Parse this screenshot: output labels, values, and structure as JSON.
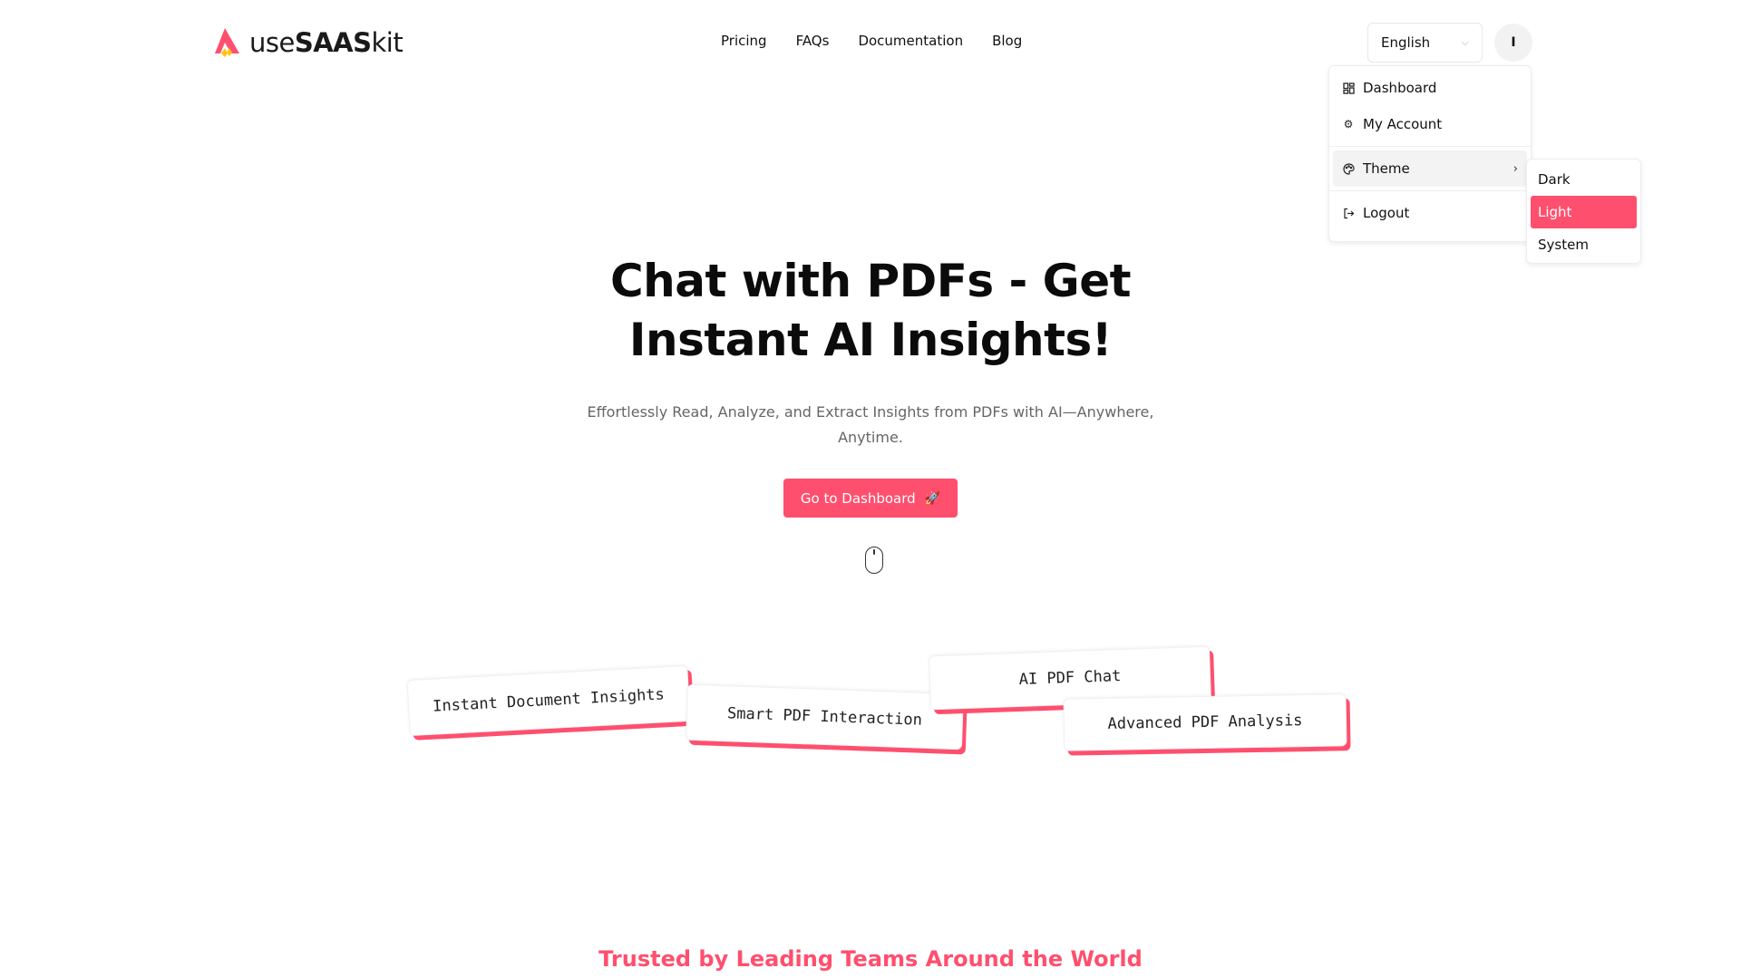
{
  "brand": {
    "logo_prefix": "use",
    "logo_bold": "SAAS",
    "logo_suffix": "kit",
    "accent_color": "#ff4f6e",
    "logo_secondary_color": "#ffc21a"
  },
  "nav": {
    "links": [
      {
        "label": "Pricing"
      },
      {
        "label": "FAQs"
      },
      {
        "label": "Documentation"
      },
      {
        "label": "Blog"
      }
    ]
  },
  "header": {
    "language": {
      "selected": "English",
      "icon": "chevron-down-icon"
    },
    "avatar_initial": "I"
  },
  "user_menu": {
    "items": [
      {
        "label": "Dashboard",
        "icon": "dashboard-icon"
      },
      {
        "label": "My Account",
        "icon": "gear-icon"
      },
      {
        "label": "Theme",
        "icon": "palette-icon",
        "has_submenu": true
      },
      {
        "label": "Logout",
        "icon": "logout-icon"
      }
    ],
    "theme_submenu": {
      "options": [
        {
          "label": "Dark"
        },
        {
          "label": "Light"
        },
        {
          "label": "System"
        }
      ],
      "selected": "Light"
    }
  },
  "hero": {
    "title_line1": "Chat with PDFs - Get",
    "title_line2": "Instant AI Insights!",
    "subtitle": "Effortlessly Read, Analyze, and Extract Insights from PDFs with AI—Anywhere, Anytime.",
    "cta_label": "Go to Dashboard",
    "cta_icon": "🚀"
  },
  "features": [
    {
      "label": "Instant Document Insights"
    },
    {
      "label": "Smart PDF Interaction"
    },
    {
      "label": "AI PDF Chat"
    },
    {
      "label": "Advanced PDF Analysis"
    }
  ],
  "trusted": {
    "heading": "Trusted by Leading Teams Around the World"
  }
}
